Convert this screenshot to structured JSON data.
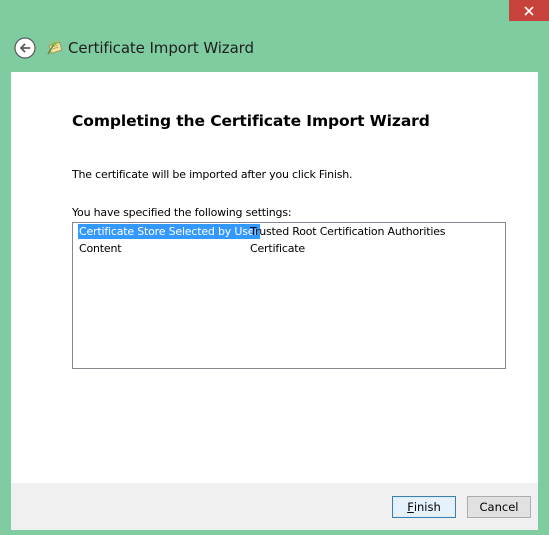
{
  "window": {
    "close_icon": "close-icon"
  },
  "header": {
    "back_icon": "back-arrow-icon",
    "wizard_icon": "certificate-wizard-icon",
    "title": "Certificate Import Wizard"
  },
  "main": {
    "heading": "Completing the Certificate Import Wizard",
    "description": "The certificate will be imported after you click Finish.",
    "settings_label": "You have specified the following settings:",
    "settings": [
      {
        "key": "Certificate Store Selected by User",
        "value": "Trusted Root Certification Authorities",
        "selected": true
      },
      {
        "key": "Content",
        "value": "Certificate",
        "selected": false
      }
    ]
  },
  "footer": {
    "finish_label_accel": "F",
    "finish_label_rest": "inish",
    "cancel_label": "Cancel"
  },
  "colors": {
    "window_frame": "#7fcca0",
    "close_button": "#c7423a",
    "selection": "#3399ff"
  }
}
